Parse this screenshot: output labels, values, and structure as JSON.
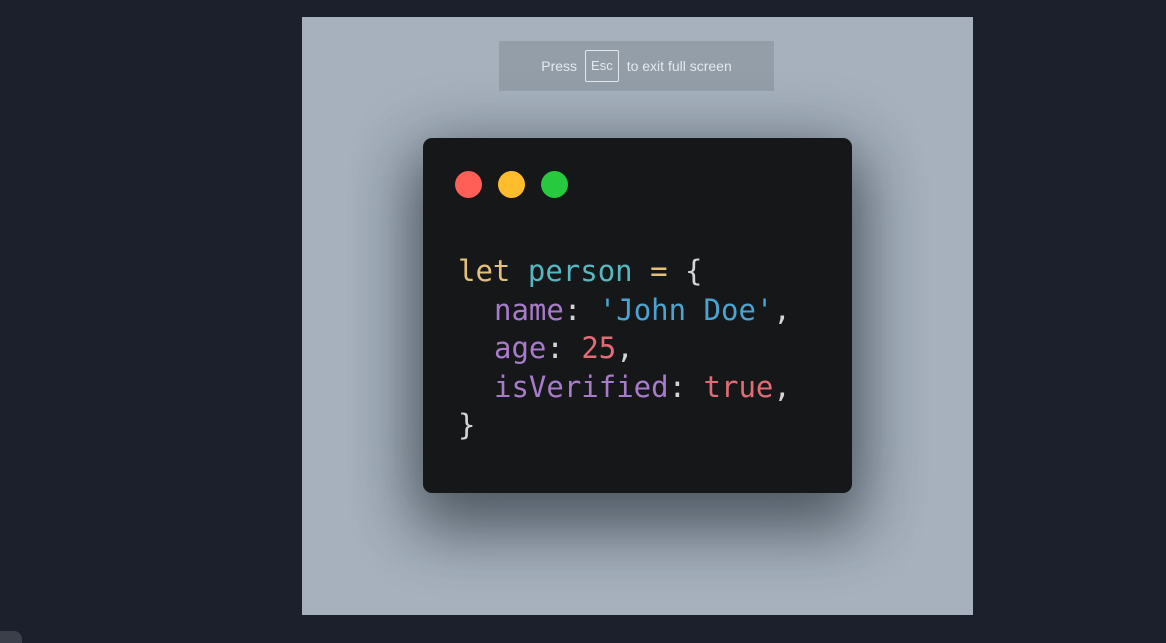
{
  "fullscreen_hint": {
    "prefix": "Press",
    "key": "Esc",
    "suffix": "to exit full screen"
  },
  "window_controls": {
    "close_color": "#ff5f56",
    "minimize_color": "#ffbd2e",
    "maximize_color": "#27c93f"
  },
  "colors": {
    "keyword": "#e5c07b",
    "variable": "#56b6c2",
    "property": "#a77bca",
    "string": "#4aa3d1",
    "number": "#e06c75",
    "boolean": "#e06c75",
    "punctuation": "#d4d4d4"
  },
  "code": {
    "line1": {
      "keyword": "let",
      "variable": "person",
      "operator": "=",
      "open_brace": "{"
    },
    "line2": {
      "key": "name",
      "colon": ":",
      "value": "'John Doe'",
      "comma": ","
    },
    "line3": {
      "key": "age",
      "colon": ":",
      "value": "25",
      "comma": ","
    },
    "line4": {
      "key": "isVerified",
      "colon": ":",
      "value": "true",
      "comma": ","
    },
    "line5": {
      "close_brace": "}"
    }
  }
}
